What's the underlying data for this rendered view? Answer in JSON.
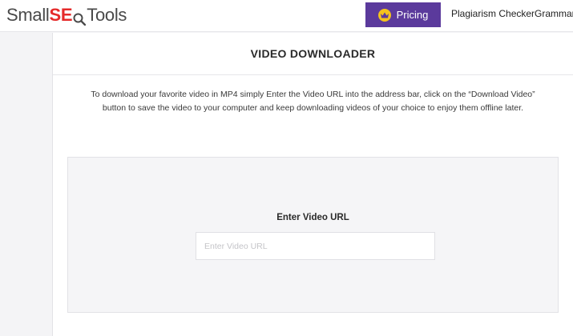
{
  "header": {
    "logo_prefix": "Small",
    "logo_seo": "SE",
    "logo_suffix": "Tools",
    "pricing_label": "Pricing",
    "nav_links": [
      "Plagiarism Checker",
      "Grammar"
    ]
  },
  "tool": {
    "title": "VIDEO DOWNLOADER",
    "description": "To download your favorite video in MP4 simply Enter the Video URL into the address bar, click on the “Download Video” button to save the video to your computer and keep downloading videos of your choice to enjoy them offline later.",
    "url_label": "Enter Video URL",
    "url_placeholder": "Enter Video URL",
    "url_value": ""
  },
  "colors": {
    "accent": "#5b3a9c",
    "crown": "#f4c21c",
    "logo_red": "#e52a2a"
  },
  "icons": {
    "crown": "crown-icon",
    "magnifier": "magnifier-icon"
  }
}
